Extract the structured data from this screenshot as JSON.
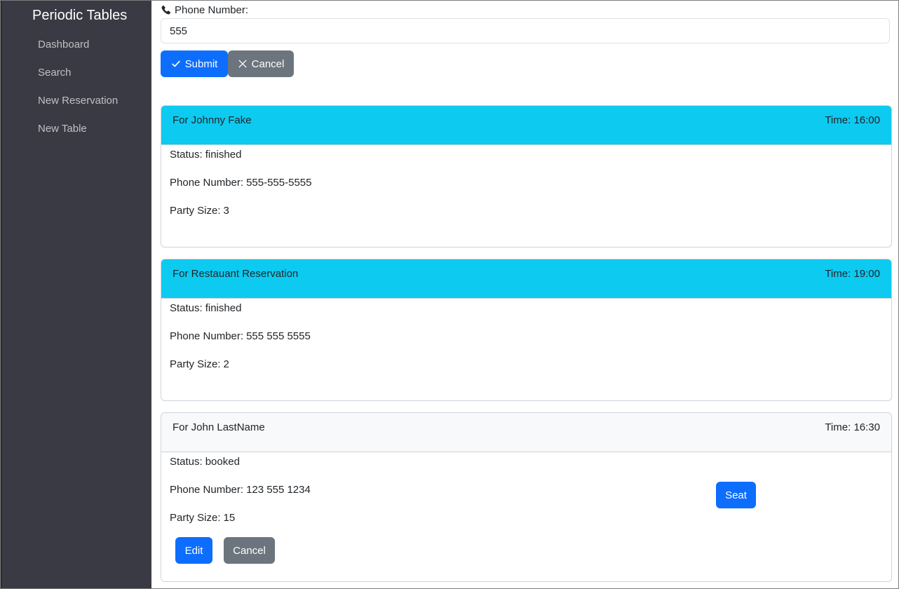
{
  "sidebar": {
    "brand": "Periodic Tables",
    "items": [
      {
        "label": "Dashboard"
      },
      {
        "label": "Search"
      },
      {
        "label": "New Reservation"
      },
      {
        "label": "New Table"
      }
    ]
  },
  "search": {
    "label": "Phone Number:",
    "value": "555",
    "submit_label": "Submit",
    "cancel_label": "Cancel"
  },
  "labels": {
    "status": "Status:",
    "phone": "Phone Number:",
    "party_size": "Party Size:",
    "time": "Time:",
    "for": "For"
  },
  "reservations": [
    {
      "name": "Johnny Fake",
      "time": "16:00",
      "status": "finished",
      "phone": "555-555-5555",
      "party_size": "3"
    },
    {
      "name": "Restauant Reservation",
      "time": "19:00",
      "status": "finished",
      "phone": "555 555 5555",
      "party_size": "2"
    },
    {
      "name": "John LastName",
      "time": "16:30",
      "status": "booked",
      "phone": "123 555 1234",
      "party_size": "15",
      "seat_label": "Seat",
      "edit_label": "Edit",
      "cancel_label": "Cancel"
    }
  ],
  "colors": {
    "sidebar": "#3a3a44",
    "primary": "#0d6efd",
    "secondary": "#6c757d",
    "info_header": "#0dcaf0",
    "booked_header": "#f8f9fa"
  },
  "icons": {
    "phone": "phone-icon",
    "check": "check-icon",
    "close": "close-icon"
  }
}
